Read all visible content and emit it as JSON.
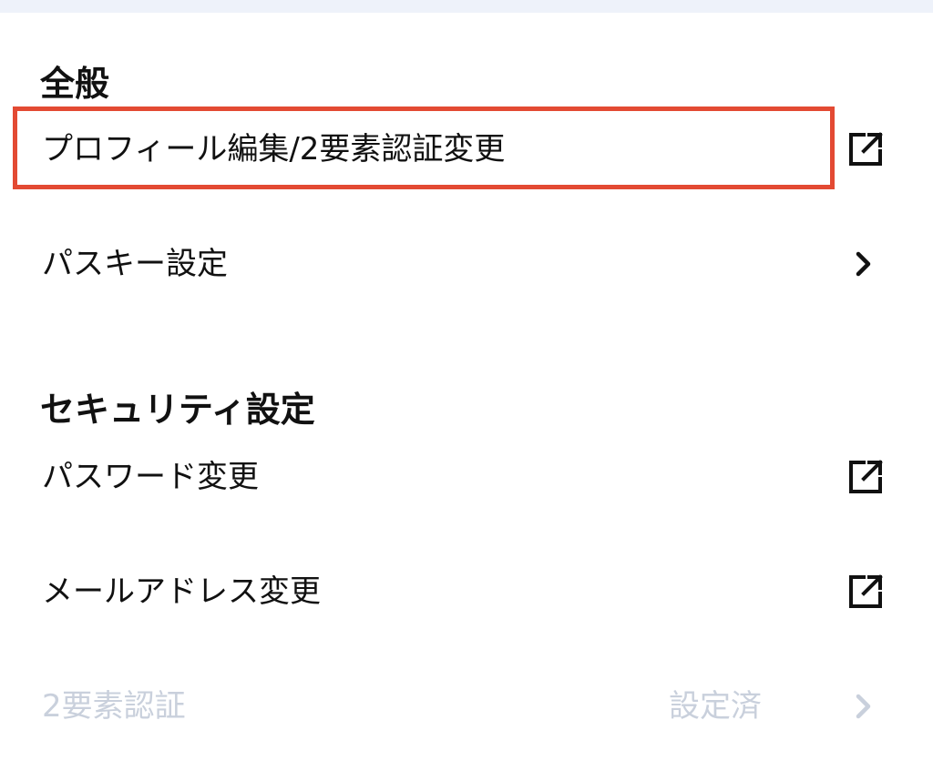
{
  "sections": {
    "general": {
      "title": "全般",
      "items": [
        {
          "label": "プロフィール編集/2要素認証変更",
          "icon": "external-link-icon"
        },
        {
          "label": "パスキー設定",
          "icon": "chevron-right-icon"
        }
      ]
    },
    "security": {
      "title": "セキュリティ設定",
      "items": [
        {
          "label": "パスワード変更",
          "icon": "external-link-icon"
        },
        {
          "label": "メールアドレス変更",
          "icon": "external-link-icon"
        },
        {
          "label": "2要素認証",
          "value": "設定済",
          "icon": "chevron-right-icon",
          "disabled": true
        }
      ]
    }
  },
  "colors": {
    "highlight": "#e34a33",
    "disabled_text": "#c9d0dc",
    "top_bar": "#eef2fa"
  }
}
